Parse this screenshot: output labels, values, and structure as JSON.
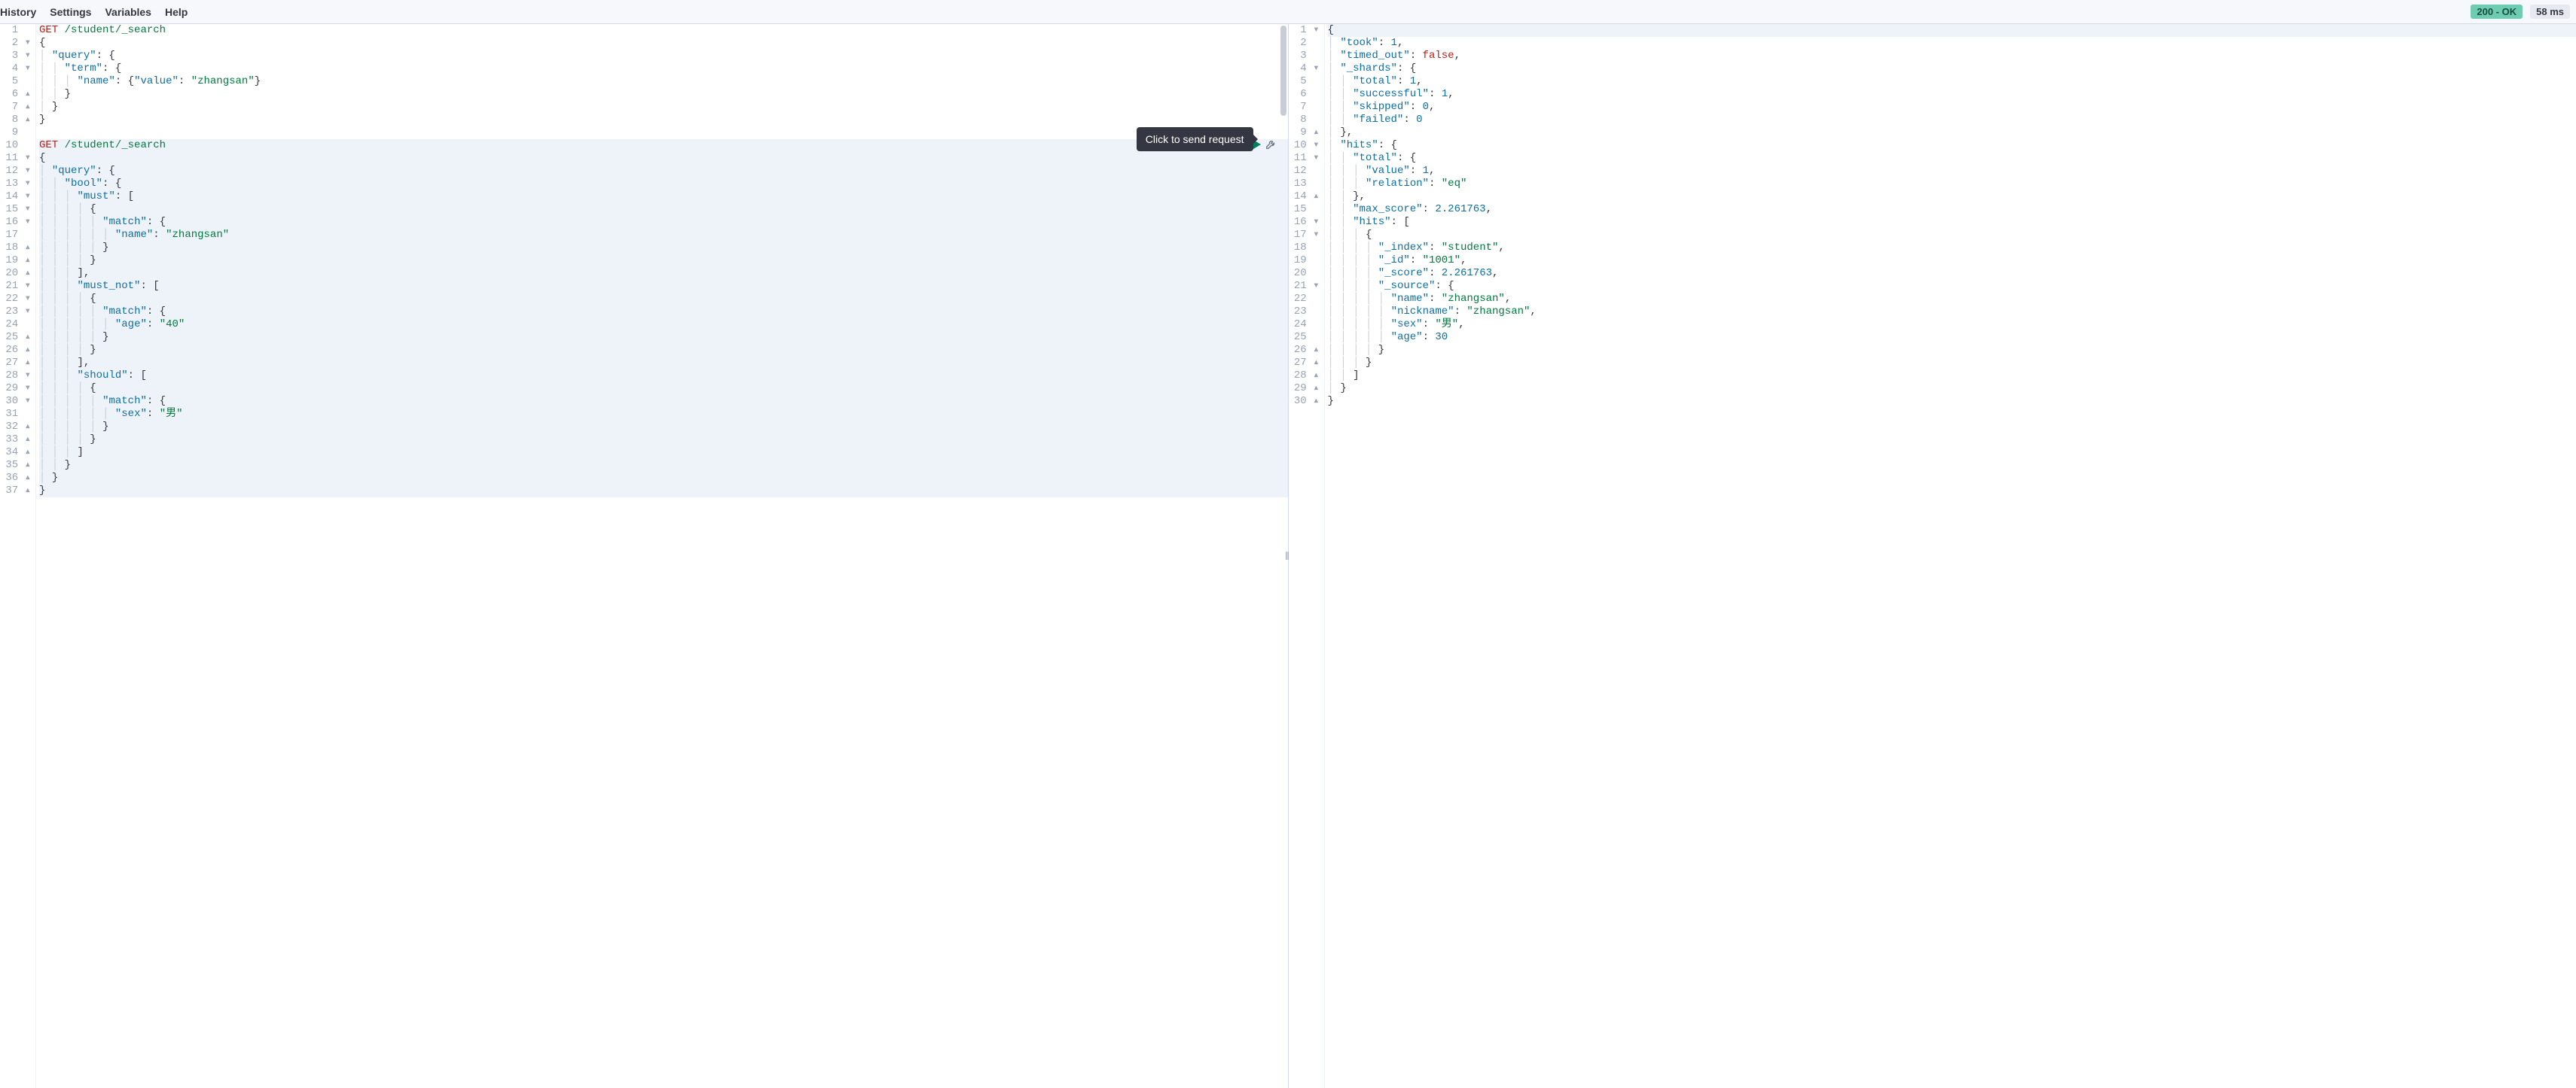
{
  "menu": {
    "history": "History",
    "settings": "Settings",
    "variables": "Variables",
    "help": "Help"
  },
  "status": {
    "code": "200 - OK",
    "time": "58 ms"
  },
  "tooltip": "Click to send request",
  "request_editor": {
    "lines": [
      {
        "n": "1",
        "marker": "",
        "tokens": [
          [
            "method",
            "GET"
          ],
          [
            "punc",
            " "
          ],
          [
            "str",
            "/student/_search"
          ]
        ]
      },
      {
        "n": "2",
        "marker": "▾",
        "tokens": [
          [
            "punc",
            "{"
          ]
        ]
      },
      {
        "n": "3",
        "marker": "▾",
        "tokens": [
          [
            "punc",
            "  "
          ],
          [
            "key",
            "\"query\""
          ],
          [
            "punc",
            ": {"
          ]
        ]
      },
      {
        "n": "4",
        "marker": "▾",
        "tokens": [
          [
            "punc",
            "    "
          ],
          [
            "key",
            "\"term\""
          ],
          [
            "punc",
            ": {"
          ]
        ]
      },
      {
        "n": "5",
        "marker": "",
        "tokens": [
          [
            "punc",
            "      "
          ],
          [
            "key",
            "\"name\""
          ],
          [
            "punc",
            ": {"
          ],
          [
            "key",
            "\"value\""
          ],
          [
            "punc",
            ": "
          ],
          [
            "str",
            "\"zhangsan\""
          ],
          [
            "punc",
            "}"
          ]
        ]
      },
      {
        "n": "6",
        "marker": "▴",
        "tokens": [
          [
            "punc",
            "    }"
          ]
        ]
      },
      {
        "n": "7",
        "marker": "▴",
        "tokens": [
          [
            "punc",
            "  }"
          ]
        ]
      },
      {
        "n": "8",
        "marker": "▴",
        "tokens": [
          [
            "punc",
            "}"
          ]
        ]
      },
      {
        "n": "9",
        "marker": "",
        "tokens": []
      },
      {
        "n": "10",
        "marker": "",
        "hl": true,
        "tokens": [
          [
            "method",
            "GET"
          ],
          [
            "punc",
            " "
          ],
          [
            "str",
            "/student/_search"
          ]
        ]
      },
      {
        "n": "11",
        "marker": "▾",
        "hl": true,
        "tokens": [
          [
            "punc",
            "{"
          ]
        ]
      },
      {
        "n": "12",
        "marker": "▾",
        "hl": true,
        "tokens": [
          [
            "punc",
            "  "
          ],
          [
            "key",
            "\"query\""
          ],
          [
            "punc",
            ": {"
          ]
        ]
      },
      {
        "n": "13",
        "marker": "▾",
        "hl": true,
        "tokens": [
          [
            "punc",
            "    "
          ],
          [
            "key",
            "\"bool\""
          ],
          [
            "punc",
            ": {"
          ]
        ]
      },
      {
        "n": "14",
        "marker": "▾",
        "hl": true,
        "tokens": [
          [
            "punc",
            "      "
          ],
          [
            "key",
            "\"must\""
          ],
          [
            "punc",
            ": ["
          ]
        ]
      },
      {
        "n": "15",
        "marker": "▾",
        "hl": true,
        "tokens": [
          [
            "punc",
            "        {"
          ]
        ]
      },
      {
        "n": "16",
        "marker": "▾",
        "hl": true,
        "tokens": [
          [
            "punc",
            "          "
          ],
          [
            "key",
            "\"match\""
          ],
          [
            "punc",
            ": {"
          ]
        ]
      },
      {
        "n": "17",
        "marker": "",
        "hl": true,
        "tokens": [
          [
            "punc",
            "            "
          ],
          [
            "key",
            "\"name\""
          ],
          [
            "punc",
            ": "
          ],
          [
            "str",
            "\"zhangsan\""
          ]
        ]
      },
      {
        "n": "18",
        "marker": "▴",
        "hl": true,
        "tokens": [
          [
            "punc",
            "          }"
          ]
        ]
      },
      {
        "n": "19",
        "marker": "▴",
        "hl": true,
        "tokens": [
          [
            "punc",
            "        }"
          ]
        ]
      },
      {
        "n": "20",
        "marker": "▴",
        "hl": true,
        "tokens": [
          [
            "punc",
            "      ],"
          ]
        ]
      },
      {
        "n": "21",
        "marker": "▾",
        "hl": true,
        "tokens": [
          [
            "punc",
            "      "
          ],
          [
            "key",
            "\"must_not\""
          ],
          [
            "punc",
            ": ["
          ]
        ]
      },
      {
        "n": "22",
        "marker": "▾",
        "hl": true,
        "tokens": [
          [
            "punc",
            "        {"
          ]
        ]
      },
      {
        "n": "23",
        "marker": "▾",
        "hl": true,
        "tokens": [
          [
            "punc",
            "          "
          ],
          [
            "key",
            "\"match\""
          ],
          [
            "punc",
            ": {"
          ]
        ]
      },
      {
        "n": "24",
        "marker": "",
        "hl": true,
        "tokens": [
          [
            "punc",
            "            "
          ],
          [
            "key",
            "\"age\""
          ],
          [
            "punc",
            ": "
          ],
          [
            "str",
            "\"40\""
          ]
        ]
      },
      {
        "n": "25",
        "marker": "▴",
        "hl": true,
        "tokens": [
          [
            "punc",
            "          }"
          ]
        ]
      },
      {
        "n": "26",
        "marker": "▴",
        "hl": true,
        "tokens": [
          [
            "punc",
            "        }"
          ]
        ]
      },
      {
        "n": "27",
        "marker": "▴",
        "hl": true,
        "tokens": [
          [
            "punc",
            "      ],"
          ]
        ]
      },
      {
        "n": "28",
        "marker": "▾",
        "hl": true,
        "tokens": [
          [
            "punc",
            "      "
          ],
          [
            "key",
            "\"should\""
          ],
          [
            "punc",
            ": ["
          ]
        ]
      },
      {
        "n": "29",
        "marker": "▾",
        "hl": true,
        "tokens": [
          [
            "punc",
            "        {"
          ]
        ]
      },
      {
        "n": "30",
        "marker": "▾",
        "hl": true,
        "tokens": [
          [
            "punc",
            "          "
          ],
          [
            "key",
            "\"match\""
          ],
          [
            "punc",
            ": {"
          ]
        ]
      },
      {
        "n": "31",
        "marker": "",
        "hl": true,
        "tokens": [
          [
            "punc",
            "            "
          ],
          [
            "key",
            "\"sex\""
          ],
          [
            "punc",
            ": "
          ],
          [
            "str",
            "\"男\""
          ]
        ]
      },
      {
        "n": "32",
        "marker": "▴",
        "hl": true,
        "tokens": [
          [
            "punc",
            "          }"
          ]
        ]
      },
      {
        "n": "33",
        "marker": "▴",
        "hl": true,
        "tokens": [
          [
            "punc",
            "        }"
          ]
        ]
      },
      {
        "n": "34",
        "marker": "▴",
        "hl": true,
        "tokens": [
          [
            "punc",
            "      ]"
          ]
        ]
      },
      {
        "n": "35",
        "marker": "▴",
        "hl": true,
        "tokens": [
          [
            "punc",
            "    }"
          ]
        ]
      },
      {
        "n": "36",
        "marker": "▴",
        "hl": true,
        "tokens": [
          [
            "punc",
            "  }"
          ]
        ]
      },
      {
        "n": "37",
        "marker": "▴",
        "hl": true,
        "tokens": [
          [
            "punc",
            "}"
          ]
        ]
      }
    ]
  },
  "response_editor": {
    "lines": [
      {
        "n": "1",
        "marker": "▾",
        "hl": true,
        "tokens": [
          [
            "punc",
            "{"
          ]
        ]
      },
      {
        "n": "2",
        "marker": "",
        "tokens": [
          [
            "punc",
            "  "
          ],
          [
            "key",
            "\"took\""
          ],
          [
            "punc",
            ": "
          ],
          [
            "num",
            "1"
          ],
          [
            "punc",
            ","
          ]
        ]
      },
      {
        "n": "3",
        "marker": "",
        "tokens": [
          [
            "punc",
            "  "
          ],
          [
            "key",
            "\"timed_out\""
          ],
          [
            "punc",
            ": "
          ],
          [
            "bool",
            "false"
          ],
          [
            "punc",
            ","
          ]
        ]
      },
      {
        "n": "4",
        "marker": "▾",
        "tokens": [
          [
            "punc",
            "  "
          ],
          [
            "key",
            "\"_shards\""
          ],
          [
            "punc",
            ": {"
          ]
        ]
      },
      {
        "n": "5",
        "marker": "",
        "tokens": [
          [
            "punc",
            "    "
          ],
          [
            "key",
            "\"total\""
          ],
          [
            "punc",
            ": "
          ],
          [
            "num",
            "1"
          ],
          [
            "punc",
            ","
          ]
        ]
      },
      {
        "n": "6",
        "marker": "",
        "tokens": [
          [
            "punc",
            "    "
          ],
          [
            "key",
            "\"successful\""
          ],
          [
            "punc",
            ": "
          ],
          [
            "num",
            "1"
          ],
          [
            "punc",
            ","
          ]
        ]
      },
      {
        "n": "7",
        "marker": "",
        "tokens": [
          [
            "punc",
            "    "
          ],
          [
            "key",
            "\"skipped\""
          ],
          [
            "punc",
            ": "
          ],
          [
            "num",
            "0"
          ],
          [
            "punc",
            ","
          ]
        ]
      },
      {
        "n": "8",
        "marker": "",
        "tokens": [
          [
            "punc",
            "    "
          ],
          [
            "key",
            "\"failed\""
          ],
          [
            "punc",
            ": "
          ],
          [
            "num",
            "0"
          ]
        ]
      },
      {
        "n": "9",
        "marker": "▴",
        "tokens": [
          [
            "punc",
            "  },"
          ]
        ]
      },
      {
        "n": "10",
        "marker": "▾",
        "tokens": [
          [
            "punc",
            "  "
          ],
          [
            "key",
            "\"hits\""
          ],
          [
            "punc",
            ": {"
          ]
        ]
      },
      {
        "n": "11",
        "marker": "▾",
        "tokens": [
          [
            "punc",
            "    "
          ],
          [
            "key",
            "\"total\""
          ],
          [
            "punc",
            ": {"
          ]
        ]
      },
      {
        "n": "12",
        "marker": "",
        "tokens": [
          [
            "punc",
            "      "
          ],
          [
            "key",
            "\"value\""
          ],
          [
            "punc",
            ": "
          ],
          [
            "num",
            "1"
          ],
          [
            "punc",
            ","
          ]
        ]
      },
      {
        "n": "13",
        "marker": "",
        "tokens": [
          [
            "punc",
            "      "
          ],
          [
            "key",
            "\"relation\""
          ],
          [
            "punc",
            ": "
          ],
          [
            "str",
            "\"eq\""
          ]
        ]
      },
      {
        "n": "14",
        "marker": "▴",
        "tokens": [
          [
            "punc",
            "    },"
          ]
        ]
      },
      {
        "n": "15",
        "marker": "",
        "tokens": [
          [
            "punc",
            "    "
          ],
          [
            "key",
            "\"max_score\""
          ],
          [
            "punc",
            ": "
          ],
          [
            "num",
            "2.261763"
          ],
          [
            "punc",
            ","
          ]
        ]
      },
      {
        "n": "16",
        "marker": "▾",
        "tokens": [
          [
            "punc",
            "    "
          ],
          [
            "key",
            "\"hits\""
          ],
          [
            "punc",
            ": ["
          ]
        ]
      },
      {
        "n": "17",
        "marker": "▾",
        "tokens": [
          [
            "punc",
            "      {"
          ]
        ]
      },
      {
        "n": "18",
        "marker": "",
        "tokens": [
          [
            "punc",
            "        "
          ],
          [
            "key",
            "\"_index\""
          ],
          [
            "punc",
            ": "
          ],
          [
            "str",
            "\"student\""
          ],
          [
            "punc",
            ","
          ]
        ]
      },
      {
        "n": "19",
        "marker": "",
        "tokens": [
          [
            "punc",
            "        "
          ],
          [
            "key",
            "\"_id\""
          ],
          [
            "punc",
            ": "
          ],
          [
            "str",
            "\"1001\""
          ],
          [
            "punc",
            ","
          ]
        ]
      },
      {
        "n": "20",
        "marker": "",
        "tokens": [
          [
            "punc",
            "        "
          ],
          [
            "key",
            "\"_score\""
          ],
          [
            "punc",
            ": "
          ],
          [
            "num",
            "2.261763"
          ],
          [
            "punc",
            ","
          ]
        ]
      },
      {
        "n": "21",
        "marker": "▾",
        "tokens": [
          [
            "punc",
            "        "
          ],
          [
            "key",
            "\"_source\""
          ],
          [
            "punc",
            ": {"
          ]
        ]
      },
      {
        "n": "22",
        "marker": "",
        "tokens": [
          [
            "punc",
            "          "
          ],
          [
            "key",
            "\"name\""
          ],
          [
            "punc",
            ": "
          ],
          [
            "str",
            "\"zhangsan\""
          ],
          [
            "punc",
            ","
          ]
        ]
      },
      {
        "n": "23",
        "marker": "",
        "tokens": [
          [
            "punc",
            "          "
          ],
          [
            "key",
            "\"nickname\""
          ],
          [
            "punc",
            ": "
          ],
          [
            "str",
            "\"zhangsan\""
          ],
          [
            "punc",
            ","
          ]
        ]
      },
      {
        "n": "24",
        "marker": "",
        "tokens": [
          [
            "punc",
            "          "
          ],
          [
            "key",
            "\"sex\""
          ],
          [
            "punc",
            ": "
          ],
          [
            "str",
            "\"男\""
          ],
          [
            "punc",
            ","
          ]
        ]
      },
      {
        "n": "25",
        "marker": "",
        "tokens": [
          [
            "punc",
            "          "
          ],
          [
            "key",
            "\"age\""
          ],
          [
            "punc",
            ": "
          ],
          [
            "num",
            "30"
          ]
        ]
      },
      {
        "n": "26",
        "marker": "▴",
        "tokens": [
          [
            "punc",
            "        }"
          ]
        ]
      },
      {
        "n": "27",
        "marker": "▴",
        "tokens": [
          [
            "punc",
            "      }"
          ]
        ]
      },
      {
        "n": "28",
        "marker": "▴",
        "tokens": [
          [
            "punc",
            "    ]"
          ]
        ]
      },
      {
        "n": "29",
        "marker": "▴",
        "tokens": [
          [
            "punc",
            "  }"
          ]
        ]
      },
      {
        "n": "30",
        "marker": "▴",
        "tokens": [
          [
            "punc",
            "}"
          ]
        ]
      }
    ]
  }
}
